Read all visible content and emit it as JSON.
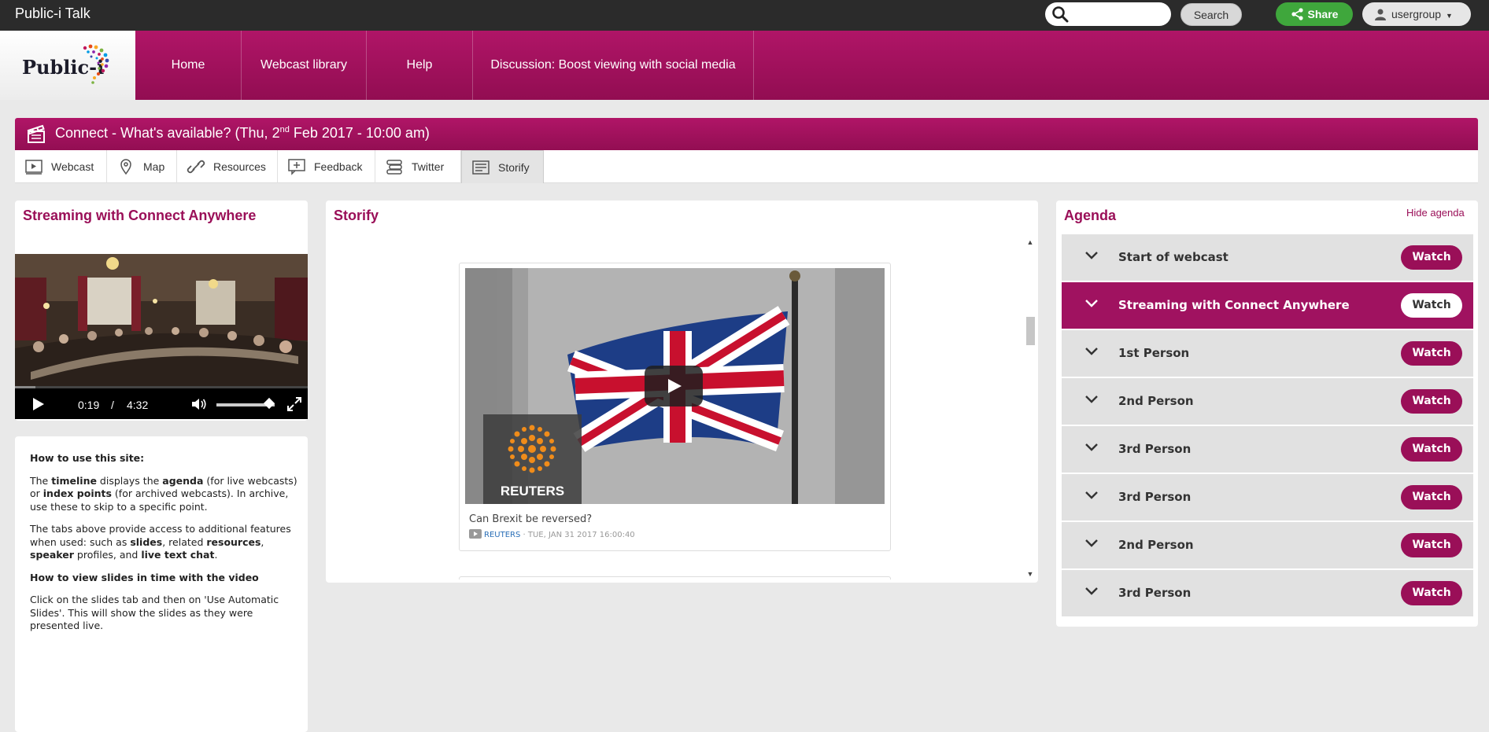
{
  "app": {
    "title": "Public-i Talk"
  },
  "topbar": {
    "search_placeholder": "",
    "search_label": "Search",
    "share_label": "Share",
    "user_label": "usergroup"
  },
  "logo": {
    "text": "Public-i"
  },
  "nav": {
    "items": [
      {
        "label": "Home"
      },
      {
        "label": "Webcast library"
      },
      {
        "label": "Help"
      },
      {
        "label": "Discussion: Boost viewing with social media"
      }
    ]
  },
  "event": {
    "title_prefix": "Connect - What's available? (Thu, 2",
    "title_sup": "nd",
    "title_suffix": " Feb 2017 - 10:00 am)"
  },
  "tabs": [
    {
      "label": "Webcast",
      "icon": "webcast-icon"
    },
    {
      "label": "Map",
      "icon": "map-pin-icon"
    },
    {
      "label": "Resources",
      "icon": "link-icon"
    },
    {
      "label": "Feedback",
      "icon": "feedback-icon"
    },
    {
      "label": "Twitter",
      "icon": "twitter-stack-icon"
    },
    {
      "label": "Storify",
      "icon": "storify-icon",
      "active": true
    }
  ],
  "left_panel": {
    "title": "Streaming with Connect Anywhere",
    "player": {
      "current_time": "0:19",
      "separator": "/",
      "duration": "4:32",
      "progress_fraction": 0.07,
      "volume_fraction": 0.9
    }
  },
  "help": {
    "heading1": "How to use this site:",
    "p1": {
      "t1": "The ",
      "b1": "timeline",
      "t2": " displays the ",
      "b2": "agenda",
      "t3": " (for live webcasts) or ",
      "b3": "index points",
      "t4": " (for archived webcasts). In archive, use these to skip to a specific point."
    },
    "p2": {
      "t1": "The tabs above provide access to additional features when used: such as ",
      "b1": "slides",
      "t2": ", related ",
      "b2": "resources",
      "t3": ", ",
      "b3": "speaker",
      "t4": " profiles, and ",
      "b4": "live text chat",
      "t5": "."
    },
    "heading2": "How to view slides in time with the video",
    "p3": "Click on the slides tab and then on 'Use Automatic Slides'. This will show the slides as they were presented live."
  },
  "storify": {
    "title": "Storify",
    "card": {
      "logo_text": "REUTERS",
      "caption": "Can Brexit be reversed?",
      "source": "REUTERS",
      "date": " · TUE, JAN 31 2017 16:00:40"
    }
  },
  "agenda": {
    "title": "Agenda",
    "hide_label": "Hide agenda",
    "watch_label": "Watch",
    "items": [
      {
        "label": "Start of webcast"
      },
      {
        "label": "Streaming with Connect Anywhere",
        "active": true
      },
      {
        "label": "1st Person"
      },
      {
        "label": "2nd Person"
      },
      {
        "label": "3rd Person"
      },
      {
        "label": "3rd Person"
      },
      {
        "label": "2nd Person"
      },
      {
        "label": "3rd Person"
      }
    ]
  },
  "colors": {
    "brand": "#9a0f58",
    "share": "#3fa73c",
    "topbar": "#2b2b2b"
  }
}
